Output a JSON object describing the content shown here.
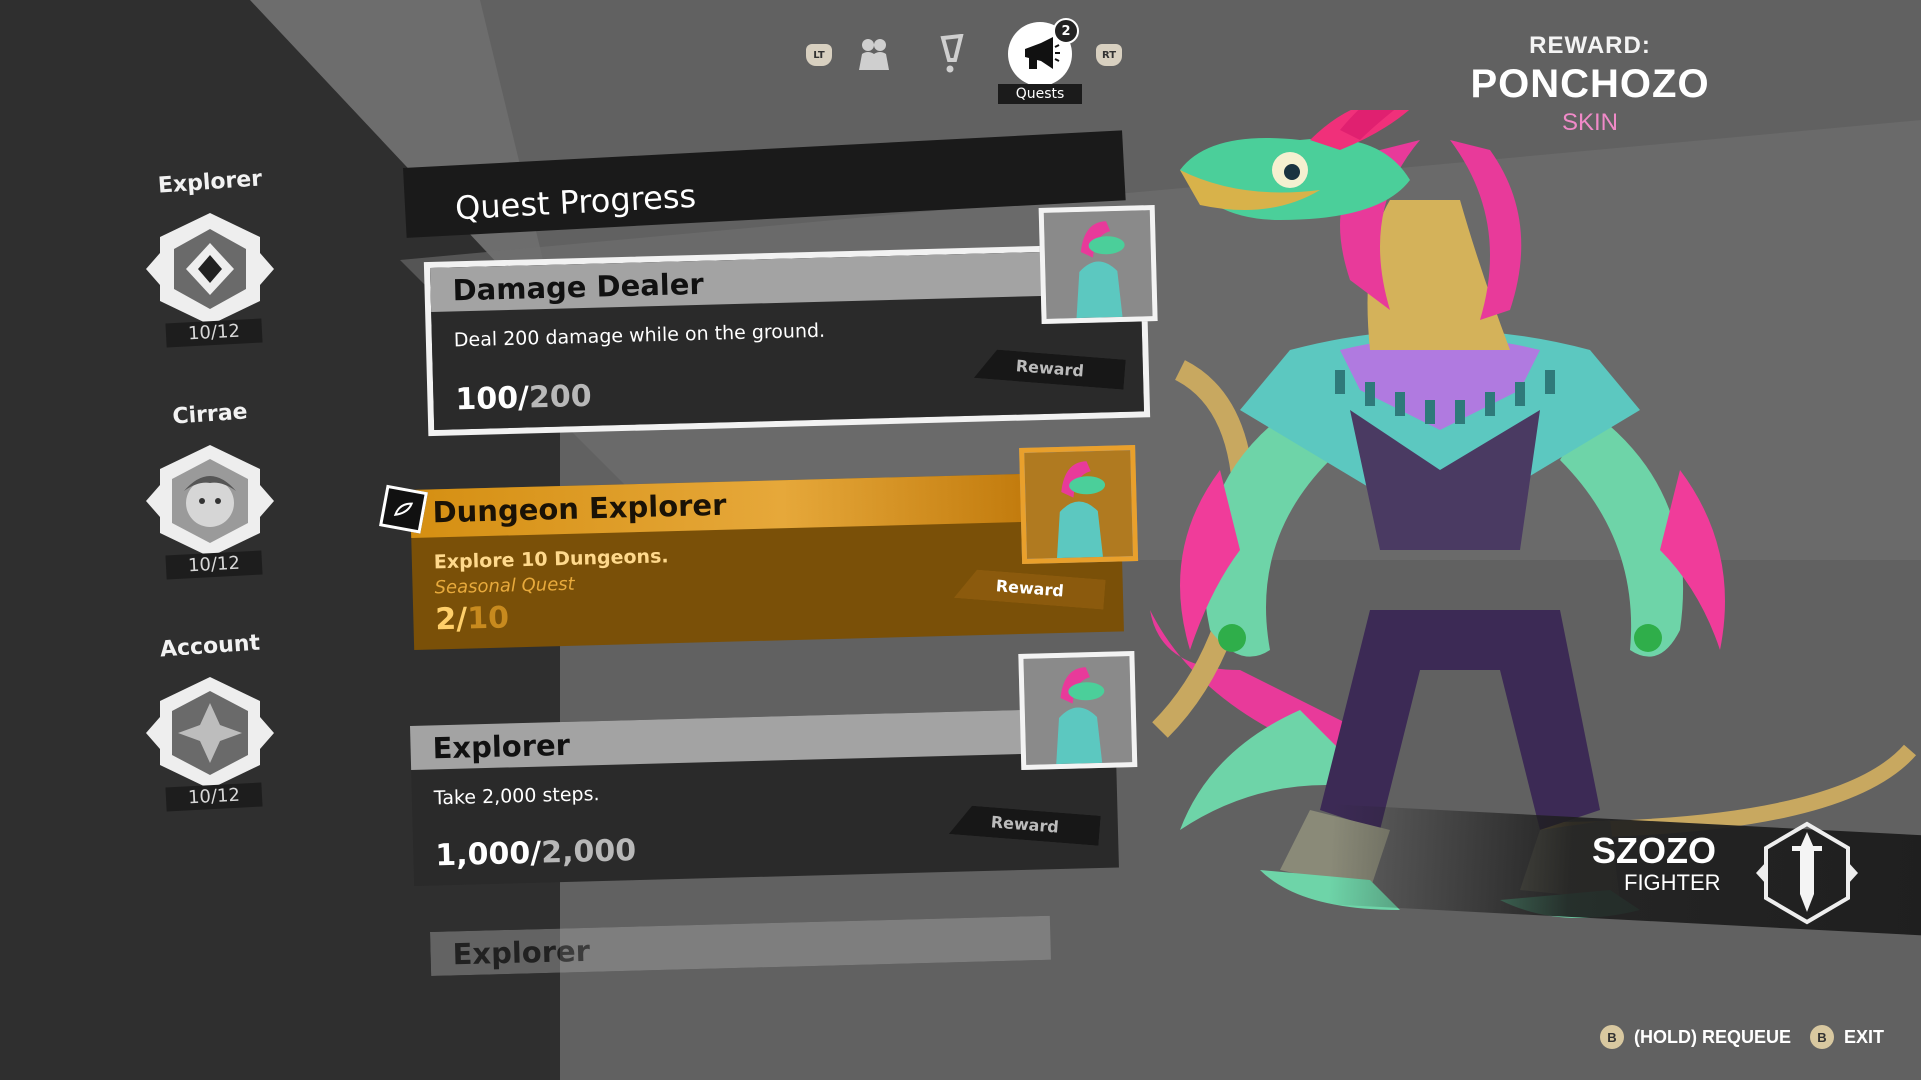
{
  "tabs": {
    "left_trigger": "LT",
    "right_trigger": "RT",
    "active_label": "Quests",
    "badge_count": "2",
    "icons": [
      "party-icon",
      "alert-icon",
      "megaphone-icon"
    ]
  },
  "reward": {
    "label": "REWARD:",
    "name": "PONCHOZO",
    "type": "SKIN"
  },
  "categories": [
    {
      "title": "Explorer",
      "progress": "10/12"
    },
    {
      "title": "Cirrae",
      "progress": "10/12"
    },
    {
      "title": "Account",
      "progress": "10/12"
    }
  ],
  "quest_header": "Quest Progress",
  "quests": [
    {
      "title": "Damage Dealer",
      "description": "Deal 200 damage while on the ground.",
      "current": "100/",
      "goal": "200",
      "reward_label": "Reward",
      "state": "normal"
    },
    {
      "title": "Dungeon Explorer",
      "description": "Explore 10 Dungeons.",
      "subtitle": "Seasonal Quest",
      "current": "2/",
      "goal": "10",
      "reward_label": "Reward",
      "state": "selected"
    },
    {
      "title": "Explorer",
      "description": "Take 2,000 steps.",
      "current": "1,000/",
      "goal": "2,000",
      "reward_label": "Reward",
      "state": "normal"
    },
    {
      "title": "Explorer",
      "state": "faded"
    }
  ],
  "character": {
    "name": "SZOZO",
    "class": "FIGHTER"
  },
  "prompts": [
    {
      "button": "B",
      "label": "(HOLD) REQUEUE"
    },
    {
      "button": "B",
      "label": "EXIT"
    }
  ],
  "colors": {
    "accent_gold": "#e6a83a",
    "skin_pink": "#f08ac8"
  }
}
